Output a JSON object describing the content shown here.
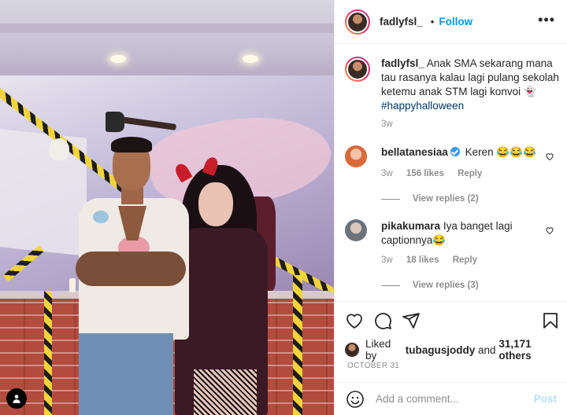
{
  "header": {
    "username": "fadlyfsl_",
    "dot": "•",
    "follow_label": "Follow",
    "more_label": "•••"
  },
  "caption": {
    "username": "fadlyfsl_",
    "text": "Anak SMA sekarang mana tau rasanya kalau lagi pulang sekolah ketemu anak STM lagi konvoi 👻",
    "hashtag": "#happyhalloween",
    "age": "3w"
  },
  "comments": [
    {
      "username": "bellatanesiaa",
      "verified": true,
      "text": "Keren 😂😂😂",
      "age": "3w",
      "likes": "156 likes",
      "reply_label": "Reply",
      "view_replies": "View replies (2)",
      "avatar_color": "#d96a3a"
    },
    {
      "username": "pikakumara",
      "verified": false,
      "text": "Iya banget lagi captionnya😂",
      "age": "3w",
      "likes": "18 likes",
      "reply_label": "Reply",
      "view_replies": "View replies (3)",
      "avatar_color": "#8a8f96"
    }
  ],
  "liked_by": {
    "prefix": "Liked by",
    "user": "tubagusjoddy",
    "and": "and",
    "others": "31,171 others"
  },
  "date": "OCTOBER 31",
  "comment_box": {
    "placeholder": "Add a comment...",
    "post_label": "Post"
  },
  "colors": {
    "accent": "#0095f6",
    "link": "#00376b",
    "muted": "#8e8e8e",
    "post_disabled": "#b2dffc"
  },
  "icons": [
    "heart-icon",
    "comment-icon",
    "share-icon",
    "save-icon",
    "emoji-icon",
    "more-icon",
    "verified-icon",
    "reels-icon"
  ]
}
